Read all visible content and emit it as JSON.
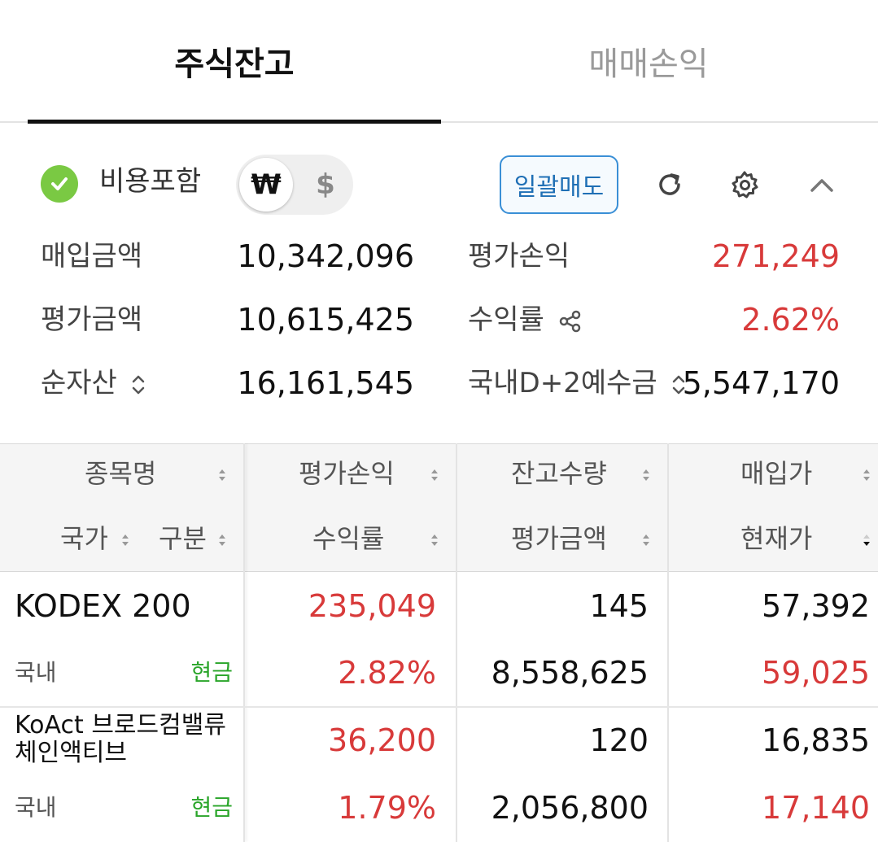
{
  "tabs": {
    "active": "주식잔고",
    "inactive": "매매손익"
  },
  "controls": {
    "fee_label": "비용포함",
    "currency_krw": "₩",
    "currency_usd": "$",
    "sell_all": "일괄매도"
  },
  "summary": {
    "purchase_label": "매입금액",
    "purchase_value": "10,342,096",
    "eval_label": "평가금액",
    "eval_value": "10,615,425",
    "net_asset_label": "순자산",
    "net_asset_value": "16,161,545",
    "eval_pl_label": "평가손익",
    "eval_pl_value": "271,249",
    "return_label": "수익률",
    "return_value": "2.62%",
    "deposit_label": "국내D+2예수금",
    "deposit_value": "5,547,170"
  },
  "table": {
    "headers": {
      "name": "종목명",
      "country": "국가",
      "type": "구분",
      "eval_pl": "평가손익",
      "return": "수익률",
      "qty": "잔고수량",
      "eval_amount": "평가금액",
      "buy_price": "매입가",
      "current_price": "현재가"
    },
    "rows": [
      {
        "name": "KODEX 200",
        "country": "국내",
        "type": "현금",
        "eval_pl": "235,049",
        "return": "2.82%",
        "qty": "145",
        "eval_amount": "8,558,625",
        "buy_price": "57,392",
        "current_price": "59,025"
      },
      {
        "name": "KoAct 브로드컴밸류체인액티브",
        "name_line1": "KoAct 브로드컴밸류",
        "name_line2": "체인액티브",
        "country": "국내",
        "type": "현금",
        "eval_pl": "36,200",
        "return": "1.79%",
        "qty": "120",
        "eval_amount": "2,056,800",
        "buy_price": "16,835",
        "current_price": "17,140"
      }
    ]
  },
  "colors": {
    "profit": "#d83a3a",
    "cash": "#2aa52a",
    "accent": "#3a8fd6",
    "check": "#7ac943"
  },
  "icons": [
    "check-icon",
    "refresh-icon",
    "gear-icon",
    "chevron-up-icon",
    "share-icon",
    "sort-icon"
  ]
}
